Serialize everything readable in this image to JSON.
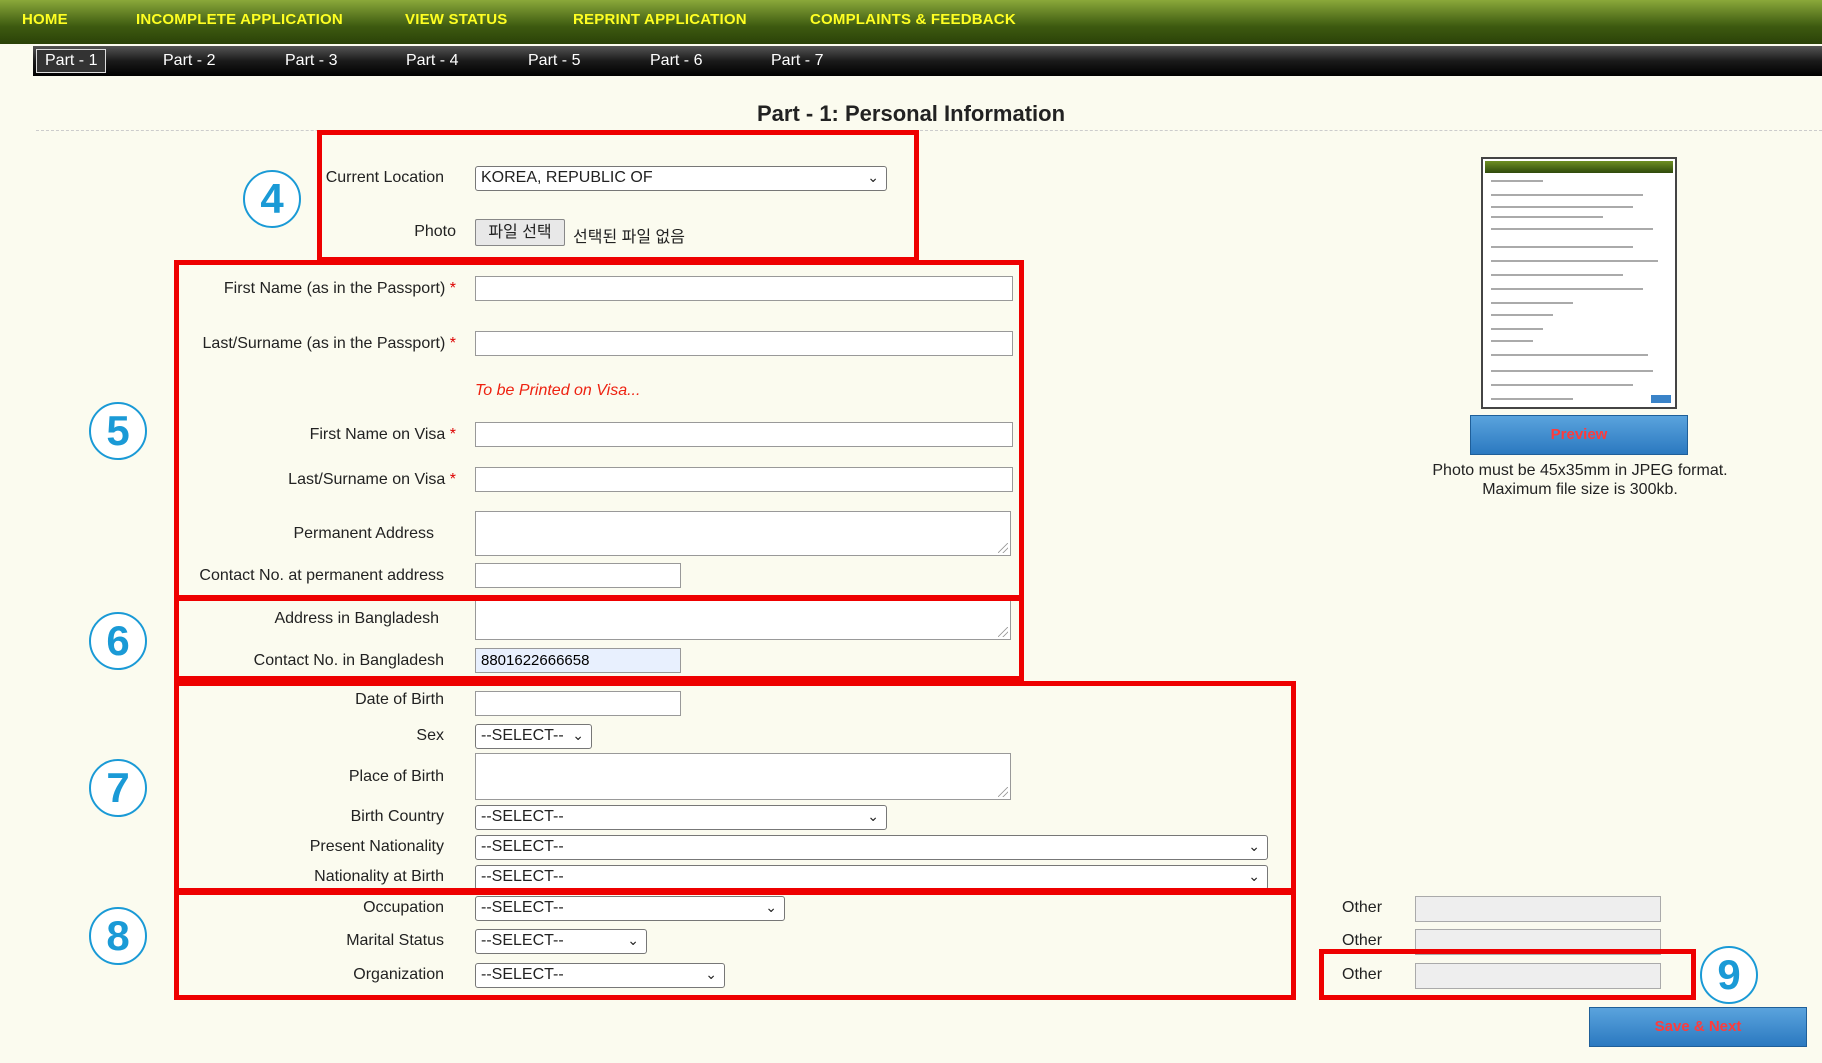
{
  "topnav": [
    "HOME",
    "INCOMPLETE APPLICATION",
    "VIEW STATUS",
    "REPRINT APPLICATION",
    "COMPLAINTS & FEEDBACK"
  ],
  "tabs": [
    "Part - 1",
    "Part - 2",
    "Part - 3",
    "Part - 4",
    "Part - 5",
    "Part - 6",
    "Part - 7"
  ],
  "page_title": "Part - 1: Personal Information",
  "form": {
    "current_location_label": "Current Location",
    "current_location_value": "KOREA, REPUBLIC OF",
    "photo_label": "Photo",
    "file_button": "파일 선택",
    "file_status": "선택된 파일 없음",
    "first_name_label": "First Name (as in the Passport)",
    "last_name_label": "Last/Surname (as in the Passport)",
    "printed_note": "To be Printed on Visa...",
    "first_name_visa_label": "First Name on Visa",
    "last_name_visa_label": "Last/Surname on Visa",
    "permanent_address_label": "Permanent Address",
    "contact_permanent_label": "Contact No. at permanent address",
    "address_bd_label": "Address in Bangladesh",
    "contact_bd_label": "Contact No. in Bangladesh",
    "contact_bd_value": "8801622666658",
    "dob_label": "Date of Birth",
    "sex_label": "Sex",
    "place_of_birth_label": "Place of Birth",
    "birth_country_label": "Birth Country",
    "present_nationality_label": "Present Nationality",
    "nationality_birth_label": "Nationality at Birth",
    "occupation_label": "Occupation",
    "marital_status_label": "Marital Status",
    "organization_label": "Organization",
    "select_default": "--SELECT--",
    "other_label": "Other",
    "required_mark": "*"
  },
  "preview": {
    "button": "Preview",
    "note_line1": "Photo must be 45x35mm in JPEG format.",
    "note_line2": "Maximum file size is 300kb."
  },
  "save_next": "Save & Next",
  "annotations": [
    "4",
    "5",
    "6",
    "7",
    "8",
    "9"
  ],
  "colors": {
    "highlight": "#ee0000",
    "callout": "#1a9ad6",
    "nav_text": "#ffff22"
  }
}
